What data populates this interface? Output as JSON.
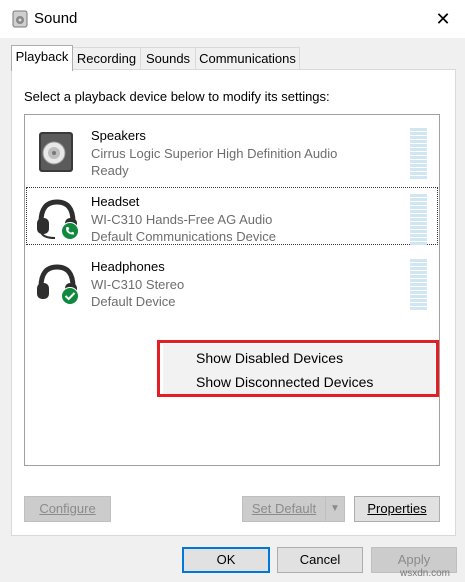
{
  "window": {
    "title": "Sound",
    "close_glyph": "✕"
  },
  "tabs": [
    {
      "label": "Playback",
      "active": true
    },
    {
      "label": "Recording",
      "active": false
    },
    {
      "label": "Sounds",
      "active": false
    },
    {
      "label": "Communications",
      "active": false
    }
  ],
  "instruction": "Select a playback device below to modify its settings:",
  "devices": [
    {
      "name": "Speakers",
      "description": "Cirrus Logic Superior High Definition Audio",
      "status": "Ready",
      "icon": "speaker-icon",
      "badge": null,
      "selected": false
    },
    {
      "name": "Headset",
      "description": "WI-C310 Hands-Free AG Audio",
      "status": "Default Communications Device",
      "icon": "headset-icon",
      "badge": "phone-badge-icon",
      "selected": true
    },
    {
      "name": "Headphones",
      "description": "WI-C310 Stereo",
      "status": "Default Device",
      "icon": "headphones-icon",
      "badge": "check-badge-icon",
      "selected": false
    }
  ],
  "context_menu": {
    "items": [
      "Show Disabled Devices",
      "Show Disconnected Devices"
    ],
    "highlight_color": "#e31e24"
  },
  "buttons": {
    "configure": {
      "label": "Configure",
      "enabled": false
    },
    "set_default": {
      "label": "Set Default",
      "enabled": false
    },
    "properties": {
      "label": "Properties",
      "enabled": true
    },
    "ok": {
      "label": "OK",
      "enabled": true
    },
    "cancel": {
      "label": "Cancel",
      "enabled": true
    },
    "apply": {
      "label": "Apply",
      "enabled": false
    }
  },
  "watermark": "wsxdn.com",
  "colors": {
    "accent": "#0078d7",
    "badge_green": "#10893e",
    "meter": "#d1e6f3"
  }
}
